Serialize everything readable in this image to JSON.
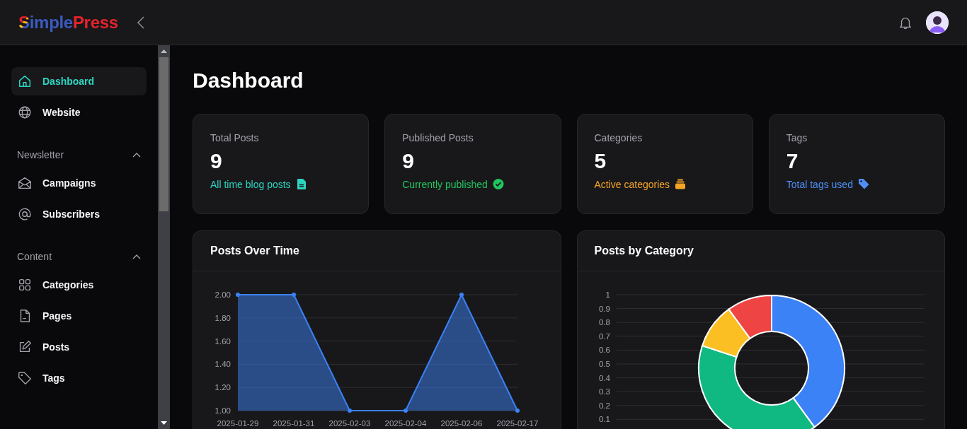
{
  "header": {
    "logo_parts": [
      "S",
      "imple",
      "Press"
    ]
  },
  "sidebar": {
    "items": [
      {
        "label": "Dashboard",
        "selected": true
      },
      {
        "label": "Website",
        "selected": false
      }
    ],
    "sections": [
      {
        "title": "Newsletter",
        "expanded": true,
        "items": [
          {
            "label": "Campaigns",
            "selected": false
          },
          {
            "label": "Subscribers",
            "selected": false
          }
        ]
      },
      {
        "title": "Content",
        "expanded": true,
        "items": [
          {
            "label": "Categories",
            "selected": false
          },
          {
            "label": "Pages",
            "selected": false
          },
          {
            "label": "Posts",
            "selected": false
          },
          {
            "label": "Tags",
            "selected": false
          }
        ]
      }
    ]
  },
  "page_title": "Dashboard",
  "stats": [
    {
      "label": "Total Posts",
      "value": "9",
      "note": "All time blog posts",
      "color": "#2dd4bf"
    },
    {
      "label": "Published Posts",
      "value": "9",
      "note": "Currently published",
      "color": "#22c55e"
    },
    {
      "label": "Categories",
      "value": "5",
      "note": "Active categories",
      "color": "#f5a524"
    },
    {
      "label": "Tags",
      "value": "7",
      "note": "Total tags used",
      "color": "#4f8ff7"
    }
  ],
  "posts_over_time": {
    "title": "Posts Over Time",
    "chart_data": {
      "type": "area",
      "categories": [
        "2025-01-29",
        "2025-01-31",
        "2025-02-03",
        "2025-02-04",
        "2025-02-06",
        "2025-02-17"
      ],
      "series": [
        {
          "color": "#3b82f6",
          "values": [
            2,
            2,
            1,
            1,
            2,
            1
          ]
        }
      ],
      "ylim": [
        1,
        2
      ],
      "grid": true,
      "yticks": [
        {
          "value": 1,
          "label": "1.00"
        },
        {
          "value": 1.2,
          "label": "1.20"
        },
        {
          "value": 1.4,
          "label": "1.40"
        },
        {
          "value": 1.6,
          "label": "1.60"
        },
        {
          "value": 1.8,
          "label": "1.80"
        },
        {
          "value": 2,
          "label": "2.00"
        }
      ]
    }
  },
  "posts_by_category": {
    "title": "Posts by Category",
    "axis_labels": [
      "1",
      "0.9",
      "0.8",
      "0.7",
      "0.6",
      "0.5",
      "0.4",
      "0.3",
      "0.2",
      "0.1"
    ]
  }
}
